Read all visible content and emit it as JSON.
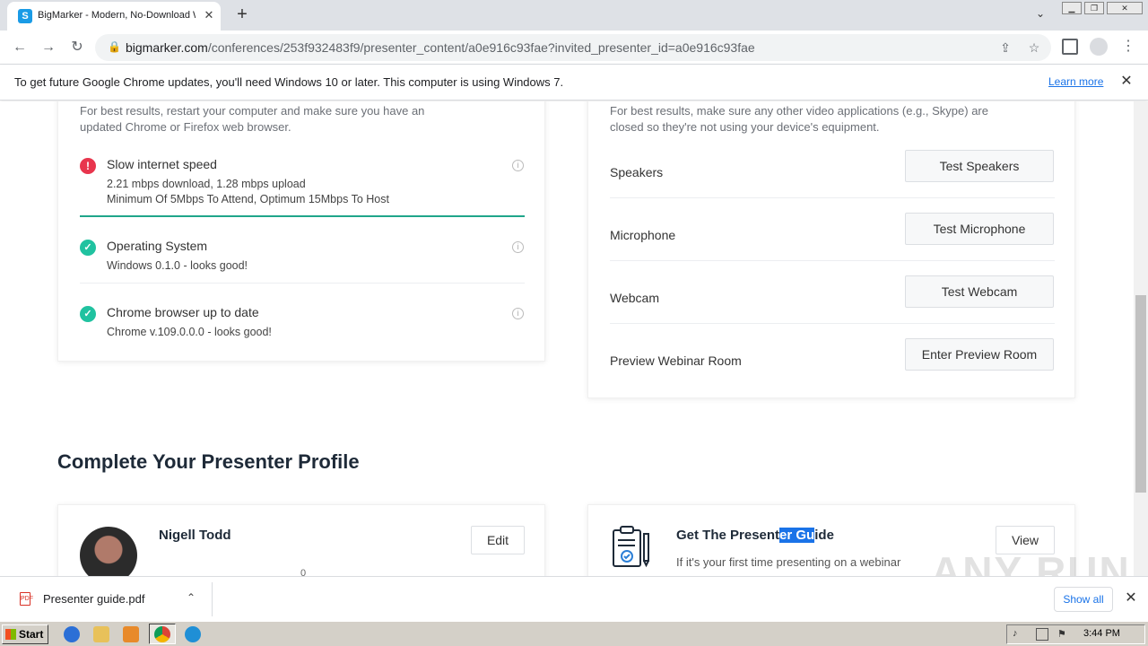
{
  "browser": {
    "tab_title": "BigMarker - Modern, No-Download W",
    "tab_favicon_letter": "S",
    "url_domain": "bigmarker.com",
    "url_path": "/conferences/253f932483f9/presenter_content/a0e916c93fae?invited_presenter_id=a0e916c93fae",
    "infobar_text": "To get future Google Chrome updates, you'll need Windows 10 or later. This computer is using Windows 7.",
    "infobar_link": "Learn more"
  },
  "system_check": {
    "intro": [
      "For best results, restart your computer and make sure you have an",
      "updated Chrome or Firefox web browser."
    ],
    "items": [
      {
        "status": "error",
        "title": "Slow internet speed",
        "details": [
          "2.21 mbps download, 1.28 mbps upload",
          "Minimum Of 5Mbps To Attend, Optimum 15Mbps To Host"
        ]
      },
      {
        "status": "ok",
        "title": "Operating System",
        "details": [
          "Windows 0.1.0 - looks good!"
        ]
      },
      {
        "status": "ok",
        "title": "Chrome browser up to date",
        "details": [
          "Chrome v.109.0.0.0 - looks good!"
        ]
      }
    ]
  },
  "devices": {
    "intro": [
      "For best results, make sure any other video applications (e.g., Skype) are",
      "closed so they're not using your device's equipment."
    ],
    "rows": [
      {
        "label": "Speakers",
        "button": "Test Speakers"
      },
      {
        "label": "Microphone",
        "button": "Test Microphone"
      },
      {
        "label": "Webcam",
        "button": "Test Webcam"
      },
      {
        "label": "Preview Webinar Room",
        "button": "Enter Preview Room"
      }
    ]
  },
  "profile_section": {
    "title": "Complete Your Presenter Profile",
    "presenter_name": "Nigell Todd",
    "edit_label": "Edit",
    "partial_number": "0",
    "guide_title_a": "Get The Present",
    "guide_title_sel": "er Gu",
    "guide_title_b": "ide",
    "guide_desc": "If it's your first time presenting on a webinar",
    "view_label": "View"
  },
  "downloads": {
    "file_name": "Presenter guide.pdf",
    "show_all": "Show all"
  },
  "watermark": "ANY RUN",
  "taskbar": {
    "start_label": "Start",
    "clock": "3:44 PM"
  }
}
